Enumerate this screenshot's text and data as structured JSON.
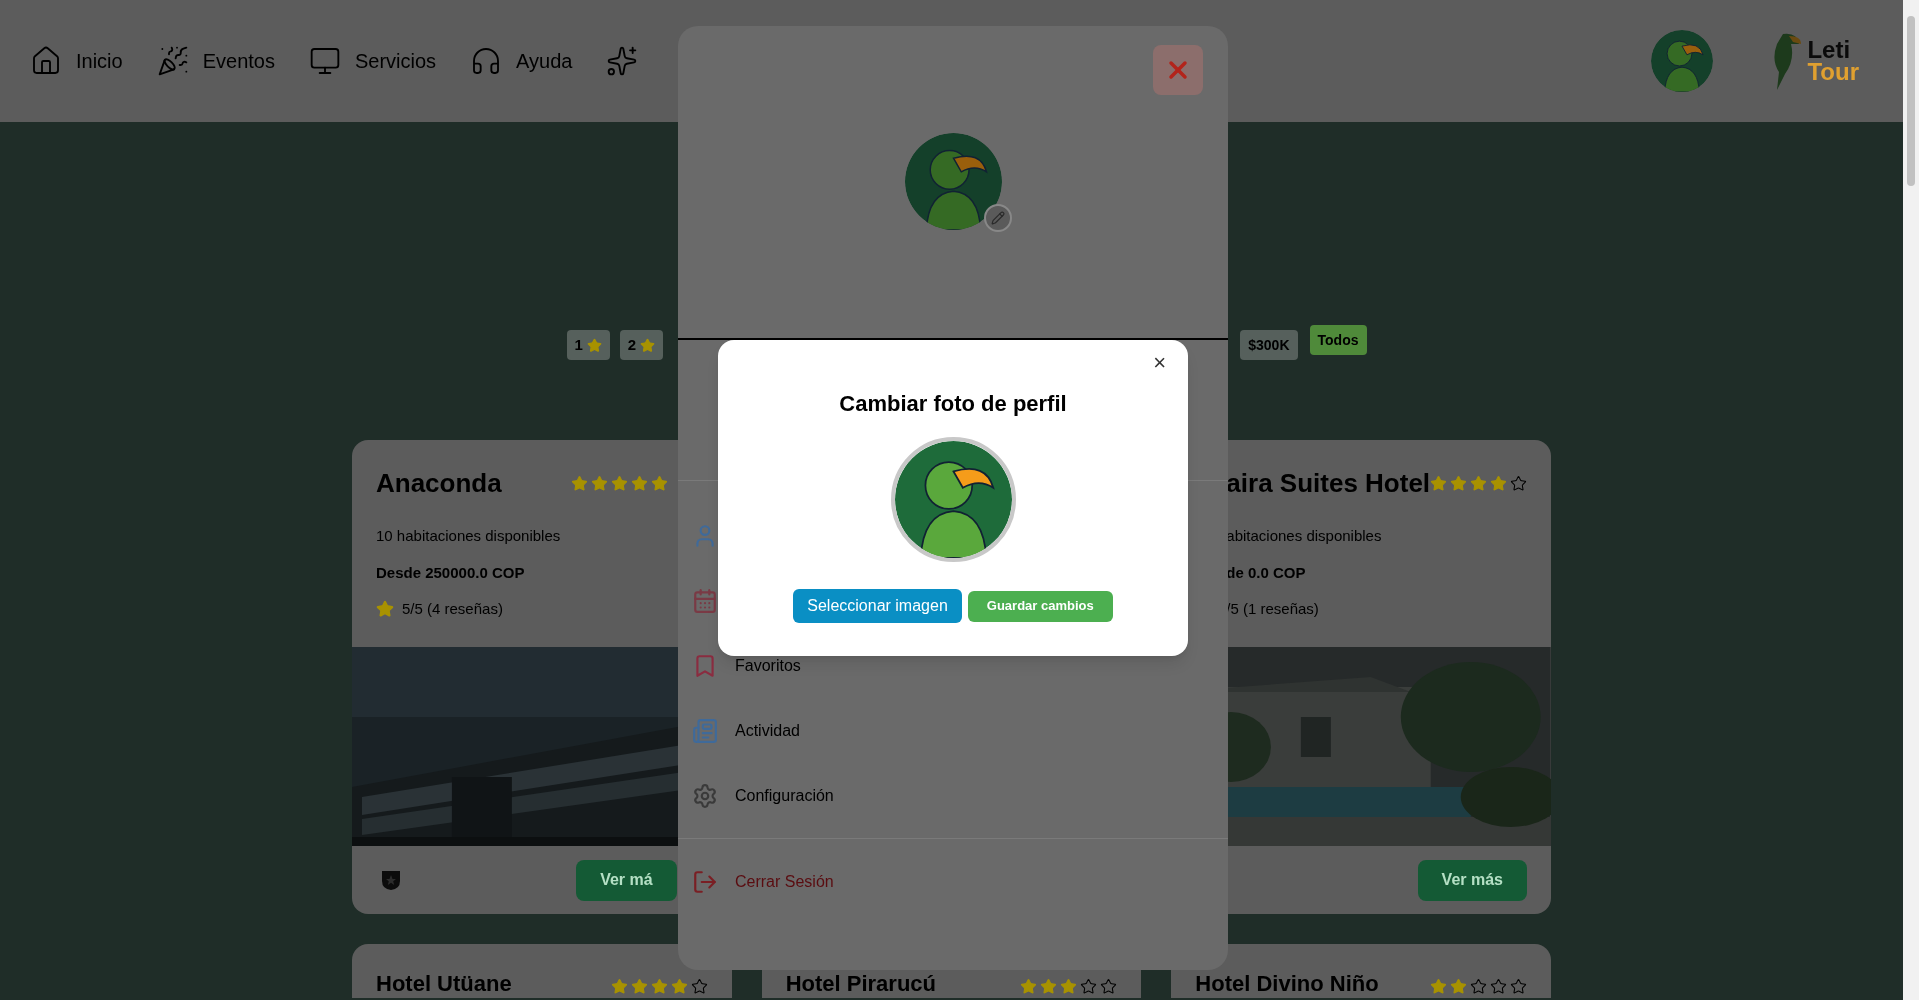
{
  "nav": {
    "items": [
      {
        "label": "Inicio"
      },
      {
        "label": "Eventos"
      },
      {
        "label": "Servicios"
      },
      {
        "label": "Ayuda"
      }
    ]
  },
  "logo": {
    "line_1": "Leti",
    "line_2": "Tour"
  },
  "filters": {
    "left": [
      {
        "label": "1",
        "selected": false
      },
      {
        "label": "2",
        "selected": false
      }
    ],
    "right": [
      {
        "label": "$300K",
        "selected": false
      },
      {
        "label": "Todos",
        "selected": true
      }
    ]
  },
  "hotels": [
    {
      "name": "Anaconda",
      "rooms": "10 habitaciones disponibles",
      "price": "Desde 250000.0 COP",
      "rating": "5/5 (4 reseñas)",
      "stars": 5,
      "button": "Ver má"
    },
    {
      "name": "aira Suites Hotel",
      "rooms": "abitaciones disponibles",
      "price": "de 0.0 COP",
      "rating": "/5 (1 reseñas)",
      "stars": 4,
      "button": "Ver más"
    }
  ],
  "more_hotels": [
    {
      "name": "Hotel Utüane",
      "stars": 4
    },
    {
      "name": "Hotel Pirarucú",
      "stars": 3
    },
    {
      "name": "Hotel Divino Niño",
      "stars": 2
    }
  ],
  "profile_panel": {
    "menu": [
      {
        "kind": "covered"
      },
      {
        "kind": "covered"
      },
      {
        "kind": "link",
        "label": "Favoritos"
      },
      {
        "kind": "link",
        "label": "Actividad"
      },
      {
        "kind": "link",
        "label": "Configuración"
      },
      {
        "kind": "logout",
        "label": "Cerrar Sesión"
      }
    ]
  },
  "dialog": {
    "close": "×",
    "title": "Cambiar foto de perfil",
    "buttons": [
      {
        "kind": "select",
        "label": "Seleccionar imagen"
      },
      {
        "kind": "save",
        "label": "Guardar cambios"
      }
    ]
  }
}
